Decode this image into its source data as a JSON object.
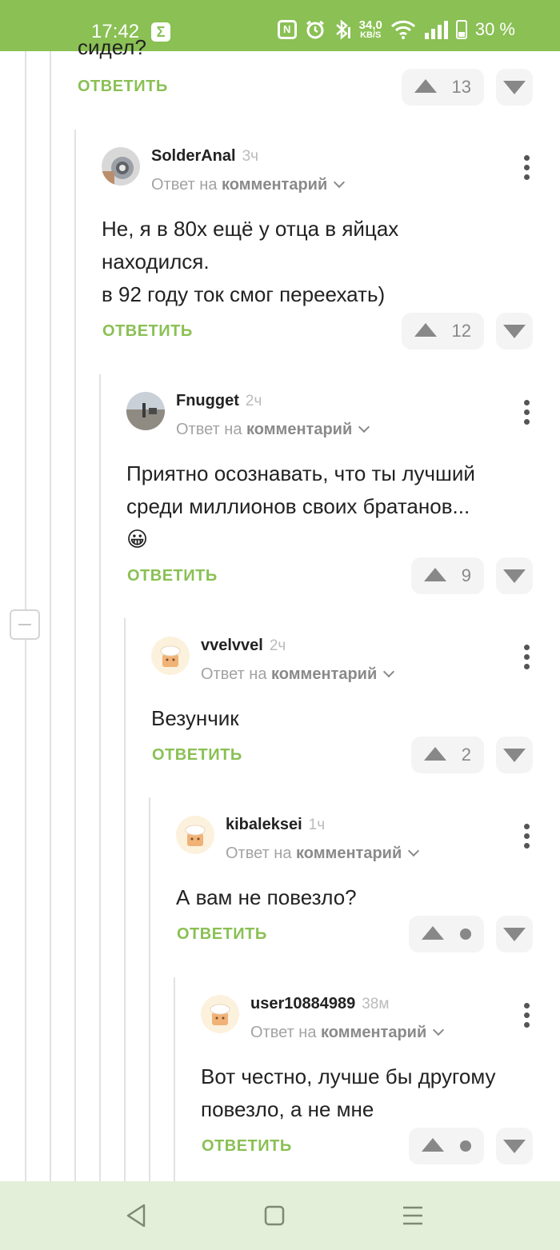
{
  "status": {
    "time": "17:42",
    "speed_value": "34,0",
    "speed_unit": "KB/S",
    "battery": "30 %",
    "nfc": "N"
  },
  "top_fragment": {
    "text": "сидел?",
    "reply_label": "ОТВЕТИТЬ",
    "votes": "13"
  },
  "comments": [
    {
      "username": "SolderAnal",
      "ago": "3ч",
      "reply_prefix": "Ответ на",
      "reply_link": "комментарий",
      "lines": [
        "Не, я в 80х ещё у отца в яйцах",
        "находился.",
        "в 92 году ток смог переехать)"
      ],
      "reply_label": "ОТВЕТИТЬ",
      "votes": "12",
      "avatar": "metal-avatar"
    },
    {
      "username": "Fnugget",
      "ago": "2ч",
      "reply_prefix": "Ответ на",
      "reply_link": "комментарий",
      "lines": [
        "Приятно осознавать, что ты лучший",
        "среди миллионов своих братанов...",
        "😀"
      ],
      "reply_label": "ОТВЕТИТЬ",
      "votes": "9",
      "avatar": "landscape-avatar"
    },
    {
      "username": "vvelvvel",
      "ago": "2ч",
      "reply_prefix": "Ответ на",
      "reply_link": "комментарий",
      "lines": [
        "Везунчик"
      ],
      "reply_label": "ОТВЕТИТЬ",
      "votes": "2",
      "avatar": "default-avatar"
    },
    {
      "username": "kibaleksei",
      "ago": "1ч",
      "reply_prefix": "Ответ на",
      "reply_link": "комментарий",
      "lines": [
        "А вам не повезло?"
      ],
      "reply_label": "ОТВЕТИТЬ",
      "votes": "",
      "avatar": "default-avatar"
    },
    {
      "username": "user10884989",
      "ago": "38м",
      "reply_prefix": "Ответ на",
      "reply_link": "комментарий",
      "lines": [
        "Вот честно, лучше бы другому",
        "повезло, а не мне"
      ],
      "reply_label": "ОТВЕТИТЬ",
      "votes": "",
      "avatar": "default-avatar"
    }
  ],
  "colors": {
    "accent": "#8ac054",
    "navbar": "#e4efd9"
  },
  "navbar": {
    "icons": [
      "back-icon",
      "home-icon",
      "menu-icon"
    ]
  }
}
